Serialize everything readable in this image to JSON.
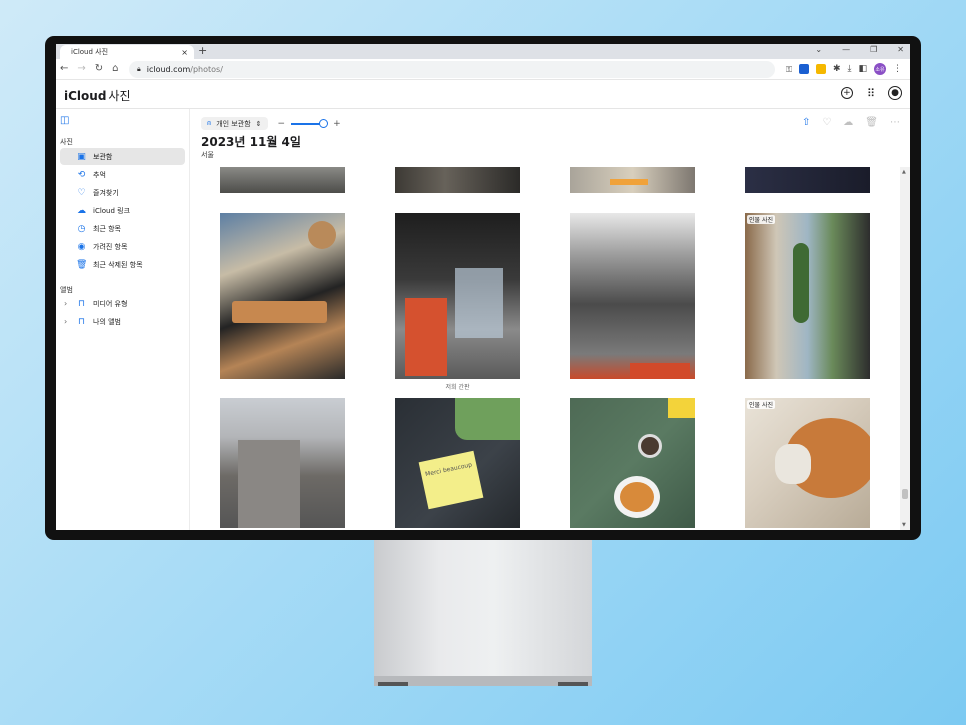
{
  "browser": {
    "tab_title": "iCloud 사진",
    "tab_close": "×",
    "new_tab": "+",
    "url_host": "icloud.com",
    "url_path": "/photos/",
    "profile_initials": "소유"
  },
  "app": {
    "brand_name": "iCloud",
    "brand_sub": "사진"
  },
  "sidebar": {
    "section_photos": "사진",
    "items": [
      {
        "label": "보관함",
        "icon": "library-icon",
        "active": true
      },
      {
        "label": "추억",
        "icon": "memories-icon"
      },
      {
        "label": "즐겨찾기",
        "icon": "heart-icon"
      },
      {
        "label": "iCloud 링크",
        "icon": "cloud-link-icon"
      },
      {
        "label": "최근 항목",
        "icon": "clock-icon"
      },
      {
        "label": "가려진 항목",
        "icon": "eye-icon"
      },
      {
        "label": "최근 삭제된 항목",
        "icon": "trash-icon"
      }
    ],
    "section_albums": "앨범",
    "albums": [
      {
        "label": "미디어 유형",
        "icon": "folder-icon"
      },
      {
        "label": "나의 앨범",
        "icon": "folder-icon"
      }
    ]
  },
  "main": {
    "library_label": "개인 보관함",
    "zoom_minus": "−",
    "zoom_plus": "+",
    "zoom_level": 0.9,
    "date_title": "2023년 11월 4일",
    "location": "서울",
    "photos": [
      {
        "badge": "",
        "caption": ""
      },
      {
        "badge": "",
        "caption": ""
      },
      {
        "badge": "",
        "caption": ""
      },
      {
        "badge": "",
        "caption": ""
      },
      {
        "badge": "",
        "caption": ""
      },
      {
        "badge": "",
        "caption": "저희 간판"
      },
      {
        "badge": "",
        "caption": ""
      },
      {
        "badge": "인물 사진",
        "caption": ""
      },
      {
        "badge": "",
        "caption": ""
      },
      {
        "badge": "",
        "caption": ""
      },
      {
        "badge": "",
        "caption": ""
      },
      {
        "badge": "인물 사진",
        "caption": ""
      }
    ],
    "sticky_note_text": "Merci beaucoup"
  },
  "colors": {
    "accent": "#1a73e8",
    "background_gradient_start": "#cfeaf8",
    "background_gradient_end": "#7ccaf2"
  }
}
